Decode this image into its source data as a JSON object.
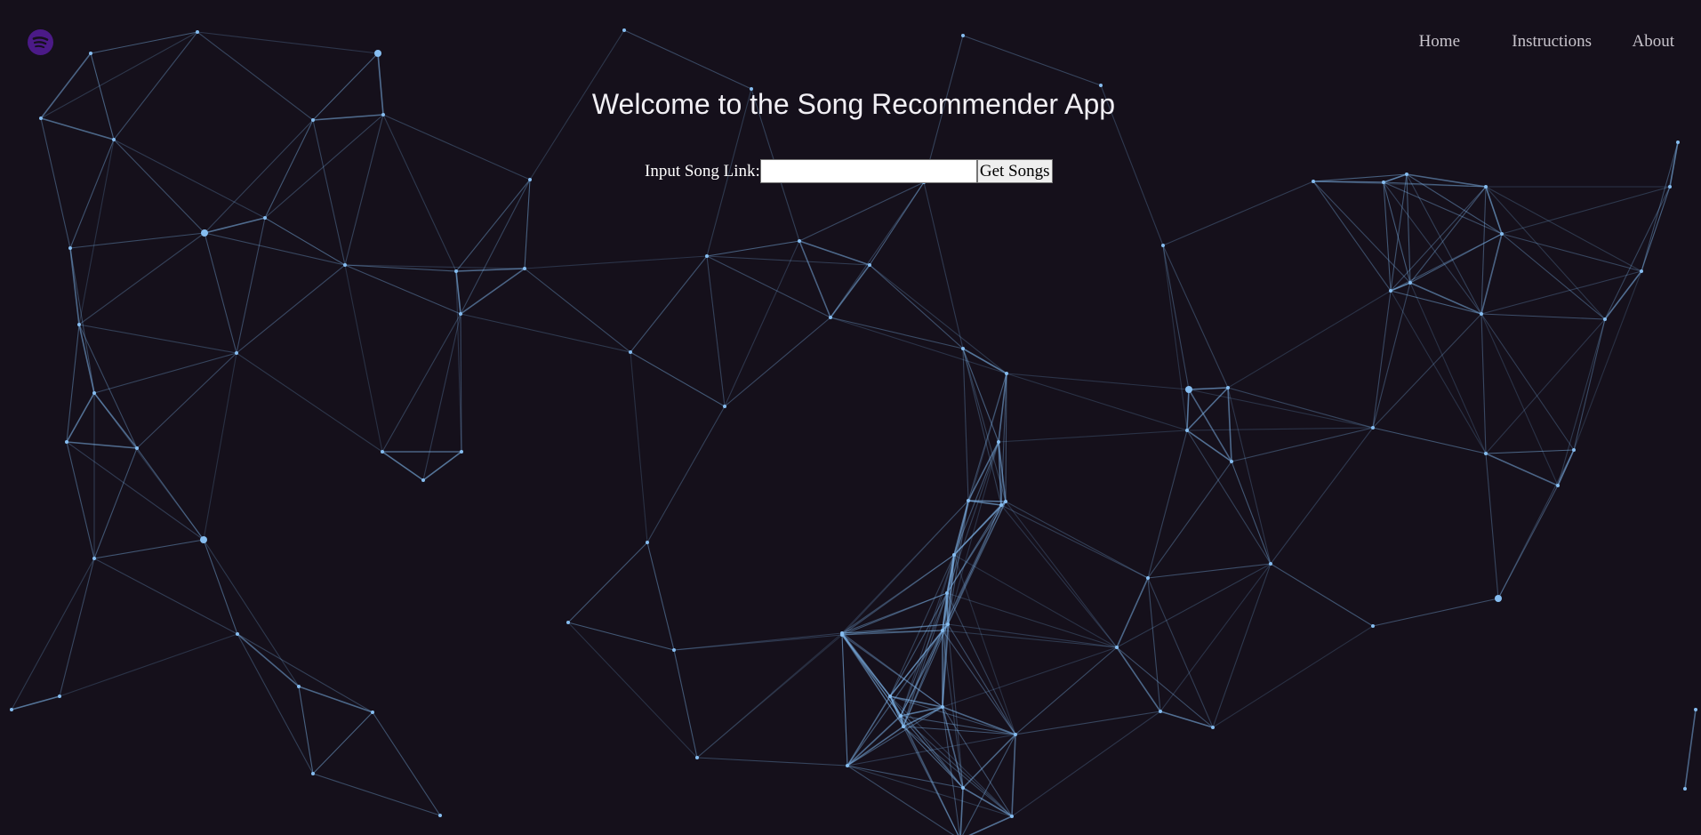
{
  "app": {
    "logo_icon": "spotify-logo-icon",
    "logo_color": "#4b1a87"
  },
  "nav": {
    "items": [
      {
        "label": "Home"
      },
      {
        "label": "Instructions"
      },
      {
        "label": "About"
      }
    ]
  },
  "main": {
    "title": "Welcome to the Song Recommender App",
    "form": {
      "label": "Input Song Link:",
      "input_value": "",
      "input_placeholder": "",
      "button_label": "Get Songs"
    }
  },
  "background": {
    "type": "particle-network",
    "line_color": "#7db3e8",
    "page_color": "#15101b"
  }
}
